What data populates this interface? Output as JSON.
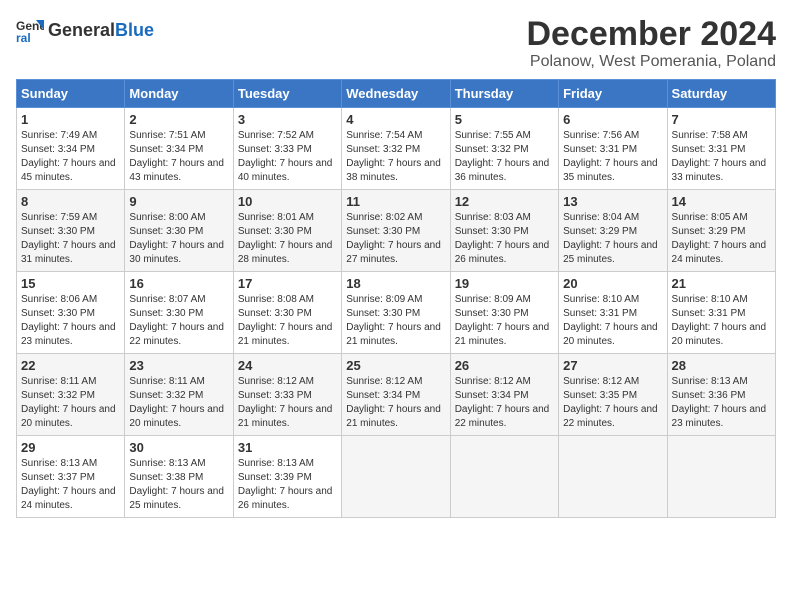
{
  "logo": {
    "text_general": "General",
    "text_blue": "Blue"
  },
  "title": "December 2024",
  "subtitle": "Polanow, West Pomerania, Poland",
  "days_header": [
    "Sunday",
    "Monday",
    "Tuesday",
    "Wednesday",
    "Thursday",
    "Friday",
    "Saturday"
  ],
  "weeks": [
    [
      {
        "day": "1",
        "sunrise": "Sunrise: 7:49 AM",
        "sunset": "Sunset: 3:34 PM",
        "daylight": "Daylight: 7 hours and 45 minutes."
      },
      {
        "day": "2",
        "sunrise": "Sunrise: 7:51 AM",
        "sunset": "Sunset: 3:34 PM",
        "daylight": "Daylight: 7 hours and 43 minutes."
      },
      {
        "day": "3",
        "sunrise": "Sunrise: 7:52 AM",
        "sunset": "Sunset: 3:33 PM",
        "daylight": "Daylight: 7 hours and 40 minutes."
      },
      {
        "day": "4",
        "sunrise": "Sunrise: 7:54 AM",
        "sunset": "Sunset: 3:32 PM",
        "daylight": "Daylight: 7 hours and 38 minutes."
      },
      {
        "day": "5",
        "sunrise": "Sunrise: 7:55 AM",
        "sunset": "Sunset: 3:32 PM",
        "daylight": "Daylight: 7 hours and 36 minutes."
      },
      {
        "day": "6",
        "sunrise": "Sunrise: 7:56 AM",
        "sunset": "Sunset: 3:31 PM",
        "daylight": "Daylight: 7 hours and 35 minutes."
      },
      {
        "day": "7",
        "sunrise": "Sunrise: 7:58 AM",
        "sunset": "Sunset: 3:31 PM",
        "daylight": "Daylight: 7 hours and 33 minutes."
      }
    ],
    [
      {
        "day": "8",
        "sunrise": "Sunrise: 7:59 AM",
        "sunset": "Sunset: 3:30 PM",
        "daylight": "Daylight: 7 hours and 31 minutes."
      },
      {
        "day": "9",
        "sunrise": "Sunrise: 8:00 AM",
        "sunset": "Sunset: 3:30 PM",
        "daylight": "Daylight: 7 hours and 30 minutes."
      },
      {
        "day": "10",
        "sunrise": "Sunrise: 8:01 AM",
        "sunset": "Sunset: 3:30 PM",
        "daylight": "Daylight: 7 hours and 28 minutes."
      },
      {
        "day": "11",
        "sunrise": "Sunrise: 8:02 AM",
        "sunset": "Sunset: 3:30 PM",
        "daylight": "Daylight: 7 hours and 27 minutes."
      },
      {
        "day": "12",
        "sunrise": "Sunrise: 8:03 AM",
        "sunset": "Sunset: 3:30 PM",
        "daylight": "Daylight: 7 hours and 26 minutes."
      },
      {
        "day": "13",
        "sunrise": "Sunrise: 8:04 AM",
        "sunset": "Sunset: 3:29 PM",
        "daylight": "Daylight: 7 hours and 25 minutes."
      },
      {
        "day": "14",
        "sunrise": "Sunrise: 8:05 AM",
        "sunset": "Sunset: 3:29 PM",
        "daylight": "Daylight: 7 hours and 24 minutes."
      }
    ],
    [
      {
        "day": "15",
        "sunrise": "Sunrise: 8:06 AM",
        "sunset": "Sunset: 3:30 PM",
        "daylight": "Daylight: 7 hours and 23 minutes."
      },
      {
        "day": "16",
        "sunrise": "Sunrise: 8:07 AM",
        "sunset": "Sunset: 3:30 PM",
        "daylight": "Daylight: 7 hours and 22 minutes."
      },
      {
        "day": "17",
        "sunrise": "Sunrise: 8:08 AM",
        "sunset": "Sunset: 3:30 PM",
        "daylight": "Daylight: 7 hours and 21 minutes."
      },
      {
        "day": "18",
        "sunrise": "Sunrise: 8:09 AM",
        "sunset": "Sunset: 3:30 PM",
        "daylight": "Daylight: 7 hours and 21 minutes."
      },
      {
        "day": "19",
        "sunrise": "Sunrise: 8:09 AM",
        "sunset": "Sunset: 3:30 PM",
        "daylight": "Daylight: 7 hours and 21 minutes."
      },
      {
        "day": "20",
        "sunrise": "Sunrise: 8:10 AM",
        "sunset": "Sunset: 3:31 PM",
        "daylight": "Daylight: 7 hours and 20 minutes."
      },
      {
        "day": "21",
        "sunrise": "Sunrise: 8:10 AM",
        "sunset": "Sunset: 3:31 PM",
        "daylight": "Daylight: 7 hours and 20 minutes."
      }
    ],
    [
      {
        "day": "22",
        "sunrise": "Sunrise: 8:11 AM",
        "sunset": "Sunset: 3:32 PM",
        "daylight": "Daylight: 7 hours and 20 minutes."
      },
      {
        "day": "23",
        "sunrise": "Sunrise: 8:11 AM",
        "sunset": "Sunset: 3:32 PM",
        "daylight": "Daylight: 7 hours and 20 minutes."
      },
      {
        "day": "24",
        "sunrise": "Sunrise: 8:12 AM",
        "sunset": "Sunset: 3:33 PM",
        "daylight": "Daylight: 7 hours and 21 minutes."
      },
      {
        "day": "25",
        "sunrise": "Sunrise: 8:12 AM",
        "sunset": "Sunset: 3:34 PM",
        "daylight": "Daylight: 7 hours and 21 minutes."
      },
      {
        "day": "26",
        "sunrise": "Sunrise: 8:12 AM",
        "sunset": "Sunset: 3:34 PM",
        "daylight": "Daylight: 7 hours and 22 minutes."
      },
      {
        "day": "27",
        "sunrise": "Sunrise: 8:12 AM",
        "sunset": "Sunset: 3:35 PM",
        "daylight": "Daylight: 7 hours and 22 minutes."
      },
      {
        "day": "28",
        "sunrise": "Sunrise: 8:13 AM",
        "sunset": "Sunset: 3:36 PM",
        "daylight": "Daylight: 7 hours and 23 minutes."
      }
    ],
    [
      {
        "day": "29",
        "sunrise": "Sunrise: 8:13 AM",
        "sunset": "Sunset: 3:37 PM",
        "daylight": "Daylight: 7 hours and 24 minutes."
      },
      {
        "day": "30",
        "sunrise": "Sunrise: 8:13 AM",
        "sunset": "Sunset: 3:38 PM",
        "daylight": "Daylight: 7 hours and 25 minutes."
      },
      {
        "day": "31",
        "sunrise": "Sunrise: 8:13 AM",
        "sunset": "Sunset: 3:39 PM",
        "daylight": "Daylight: 7 hours and 26 minutes."
      },
      null,
      null,
      null,
      null
    ]
  ]
}
